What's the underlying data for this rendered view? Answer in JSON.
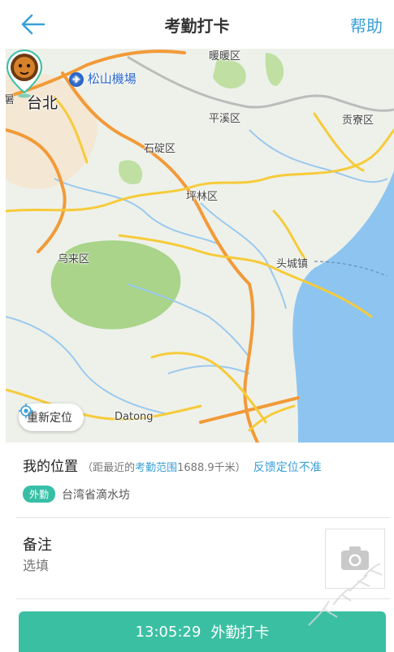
{
  "header": {
    "title": "考勤打卡",
    "help_label": "帮助",
    "back_icon": "arrow-left-icon"
  },
  "map": {
    "labels": {
      "taipei": "台北",
      "airport": "松山機場",
      "pingxi": "平溪区",
      "gongliao": "贡寮区",
      "shiding": "石碇区",
      "pinglin": "坪林区",
      "wulai": "乌来区",
      "toucheng": "头城镇",
      "datong": "Datong",
      "top": "暖暖区",
      "left_edge": "暑"
    },
    "relocate_label": "重新定位"
  },
  "location": {
    "title": "我的位置",
    "note_prefix": "（距最近的",
    "note_link": "考勤范围",
    "note_suffix": "1688.9千米）",
    "feedback": "反馈定位不准",
    "badge": "外勤",
    "address": "台湾省滴水坊"
  },
  "remark": {
    "title": "备注",
    "placeholder": "选填"
  },
  "clock": {
    "time": "13:05:29",
    "label": "外勤打卡"
  },
  "colors": {
    "accent": "#3aa0d8",
    "button": "#3bbfa3",
    "badge": "#37bfa6"
  }
}
